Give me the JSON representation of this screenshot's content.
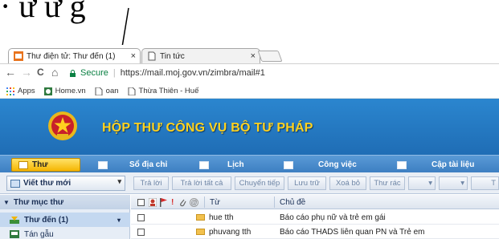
{
  "caption": {
    "text": "·     ư    ư      g"
  },
  "browser": {
    "tabs": [
      {
        "title": "Thư điện tử: Thư đến (1)",
        "close": "×"
      },
      {
        "title": "Tin tức",
        "close": "×"
      }
    ],
    "nav": {
      "back": "←",
      "forward": "→",
      "reload": "C",
      "home": "⌂"
    },
    "address": {
      "secure_label": "Secure",
      "divider": "|",
      "url": "https://mail.moj.gov.vn/zimbra/mail#1"
    },
    "bookmarks": [
      "Apps",
      "Home.vn",
      "oan",
      "Thừa Thiên - Huế"
    ]
  },
  "app": {
    "banner_title": "HỘP THƯ CÔNG VỤ BỘ TƯ PHÁP",
    "tabs": [
      "Thư",
      "Sổ địa chỉ",
      "Lịch",
      "Công việc",
      "Cập tài liệu"
    ],
    "toolbar": {
      "new_mail": "Viết thư mới",
      "dropdown": "▾",
      "buttons": [
        "Trả lời",
        "Trả lời tất cả",
        "Chuyển tiếp",
        "Lưu trữ",
        "Xoá bỏ",
        "Thư rác"
      ],
      "trailing_buttons": [
        "▾",
        "▾",
        "T"
      ]
    },
    "sidebar": {
      "header": "Thư mục thư",
      "items": [
        {
          "label": "Thư đến (1)",
          "expand": "▾"
        },
        {
          "label": "Tán gẫu"
        }
      ]
    },
    "message_list": {
      "columns": {
        "from": "Từ",
        "subject": "Chủ đề",
        "attachment": "@"
      },
      "rows": [
        {
          "from": "hue tth",
          "subject": "Báo cáo phụ nữ và trẻ em gái"
        },
        {
          "from": "phuvang tth",
          "subject": "Báo cáo THADS liên quan PN và Trẻ em"
        }
      ]
    },
    "colors": {
      "banner_blue": "#1f6db5",
      "title_yellow": "#ffd21f",
      "secure_green": "#0b8043",
      "active_tab": "#f5b500"
    }
  }
}
